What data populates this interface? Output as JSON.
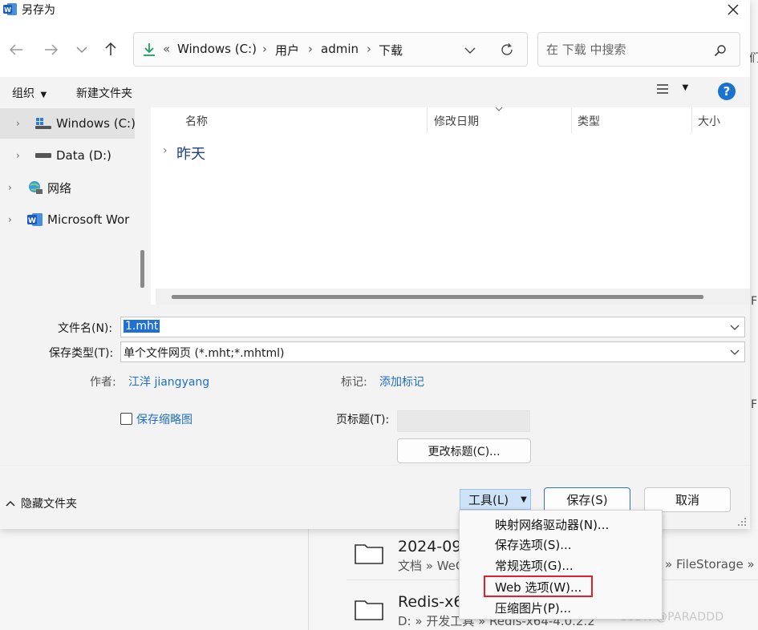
{
  "window": {
    "title": "另存为"
  },
  "address": {
    "crumbs": [
      "Windows (C:)",
      "用户",
      "admin",
      "下载"
    ],
    "overflow": "«"
  },
  "search": {
    "placeholder": "在 下载 中搜索"
  },
  "toolbar": {
    "organize": "组织",
    "new_folder": "新建文件夹",
    "help": "?"
  },
  "nav_tree": [
    {
      "label": "Windows (C:)",
      "icon": "drive-icon"
    },
    {
      "label": "Data (D:)",
      "icon": "drive-icon"
    },
    {
      "label": "网络",
      "icon": "network-icon"
    },
    {
      "label": "Microsoft Wor",
      "icon": "word-icon"
    }
  ],
  "file_list": {
    "columns": [
      "名称",
      "修改日期",
      "类型",
      "大小"
    ],
    "groups": [
      "昨天"
    ]
  },
  "form": {
    "filename_label": "文件名(N):",
    "filename_value": "1.mht",
    "filetype_label": "保存类型(T):",
    "filetype_value": "单个文件网页 (*.mht;*.mhtml)",
    "author_label": "作者:",
    "author_value": "江洋 jiangyang",
    "tags_label": "标记:",
    "tags_value": "添加标记",
    "thumbnail_label": "保存缩略图",
    "page_title_label": "页标题(T):",
    "change_title_button": "更改标题(C)..."
  },
  "bottom": {
    "hide_folders": "隐藏文件夹",
    "tools": "工具(L)",
    "save": "保存(S)",
    "cancel": "取消"
  },
  "tools_menu": [
    "映射网络驱动器(N)...",
    "保存选项(S)...",
    "常规选项(G)...",
    "Web 选项(W)...",
    "压缩图片(P)..."
  ],
  "background": {
    "edge_texts": [
      "们",
      "F",
      "F"
    ],
    "rows": [
      {
        "name": "2024-09",
        "path_start": "文档 » WeC",
        "path_end": "» FileStorage » F"
      },
      {
        "name": "Redis-x6",
        "path_start": "D: » 开发工具 » Redis-x64-4.0.2.2",
        "path_end": ""
      }
    ]
  },
  "watermark": "CSDN @PARADDD",
  "colors": {
    "accent": "#1f6fd6",
    "link": "#1f6fc5",
    "highlight_box": "#e0202a",
    "download_arrow": "#1aa260"
  }
}
